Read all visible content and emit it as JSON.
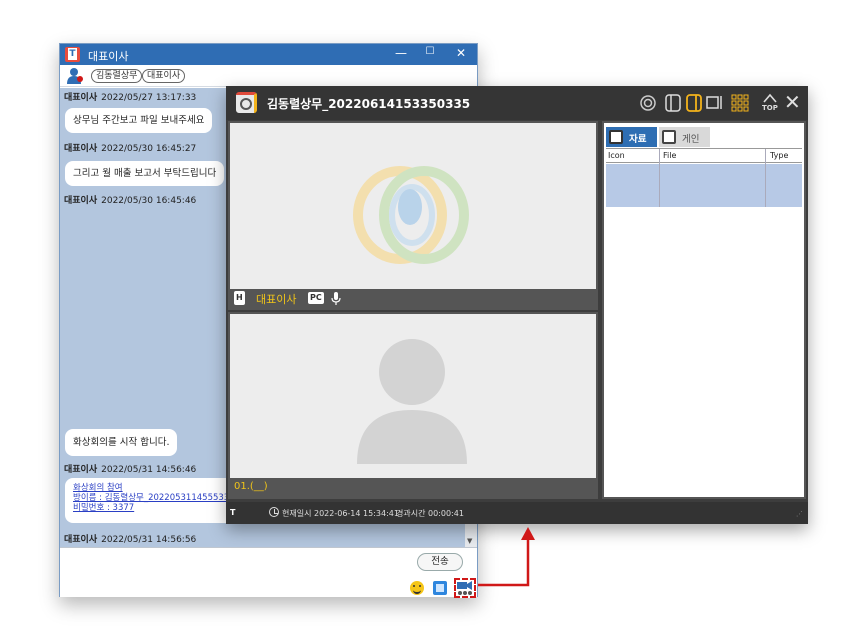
{
  "chat_window": {
    "title": "대표이사",
    "controls": {
      "minimize": "—",
      "maximize": "☐",
      "close": "✕"
    },
    "participants": [
      "김동렬상무",
      "대표이사"
    ],
    "messages": [
      {
        "sender": "대표이사",
        "time": "2022/05/27 13:17:33",
        "text": "상무님 주간보고 파일 보내주세요"
      },
      {
        "sender": "대표이사",
        "time": "2022/05/30 16:45:27",
        "text": "그리고 월 매출 보고서 부탁드립니다"
      },
      {
        "sender": "대표이사",
        "time": "2022/05/30 16:45:46"
      },
      {
        "text": "화상회의를 시작 합니다."
      },
      {
        "sender": "대표이사",
        "time": "2022/05/31 14:56:46",
        "link_lines": [
          "화상회의 참여",
          "방이름 : 김동렬상무_20220531145553370",
          "비밀번호 : 3377"
        ]
      },
      {
        "sender": "대표이사",
        "time": "2022/05/31 14:56:56"
      }
    ],
    "send_label": "전송",
    "input_icons": [
      "emoji-icon",
      "file-icon",
      "video-call-icon"
    ]
  },
  "video_window": {
    "title": "김동렬상무_20220614153350335",
    "toolbar_icons": [
      "record-icon",
      "layout-single-icon",
      "layout-split-icon",
      "layout-side-icon",
      "grid-icon",
      "top-icon",
      "close-icon"
    ],
    "top_label": "TOP",
    "close_label": "✕",
    "participant1": {
      "badge": "H",
      "name": "대표이사",
      "device": "PC"
    },
    "participant2": {
      "name": "01.(__)"
    },
    "side_tabs": {
      "files": "자료",
      "notice": "게인"
    },
    "file_columns": [
      "Icon",
      "File",
      "Type"
    ],
    "status": {
      "t": "T",
      "current_time": "현재일시 2022-06-14 15:34:41",
      "elapsed": "경과시간 00:00:41"
    }
  },
  "colors": {
    "accent_blue": "#2f6db4",
    "chat_bg": "#b3c6de",
    "highlight_red": "#d01818",
    "name_yellow": "#f0c419"
  }
}
